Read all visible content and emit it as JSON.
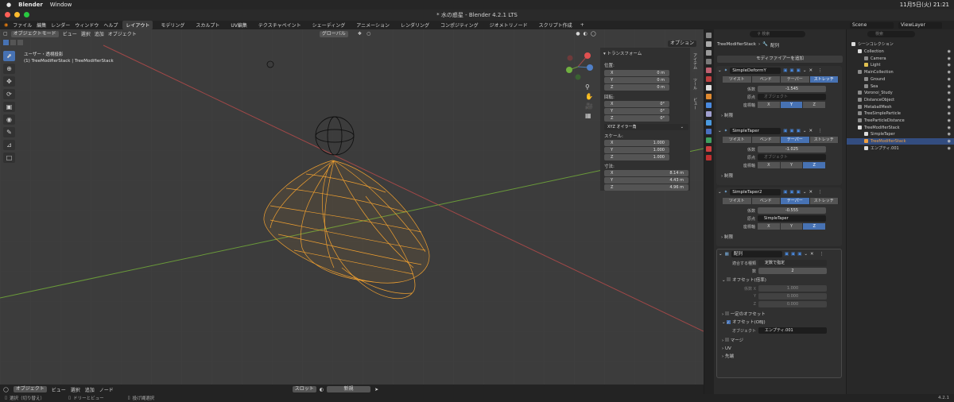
{
  "mac": {
    "app": "Blender",
    "menus": [
      "Window"
    ],
    "clock": "11月5日(火) 21:21"
  },
  "titlebar": {
    "title": "* 水の惑星 - Blender 4.2.1 LTS"
  },
  "topmenu": {
    "items": [
      "ファイル",
      "編集",
      "レンダー",
      "ウィンドウ",
      "ヘルプ"
    ],
    "tabs": [
      "レイアウト",
      "モデリング",
      "スカルプト",
      "UV編集",
      "テクスチャペイント",
      "シェーディング",
      "アニメーション",
      "レンダリング",
      "コンポジティング",
      "ジオメトリノード",
      "スクリプト作成"
    ],
    "add_tab": "+",
    "scene": "Scene",
    "viewlayer": "ViewLayer"
  },
  "viewport": {
    "mode": "オブジェクトモード",
    "menus": [
      "ビュー",
      "選択",
      "追加",
      "オブジェクト"
    ],
    "transform_orient": "グローバル",
    "options": "オプション",
    "overlay_text_1": "ユーザー・透視投影",
    "overlay_text_2": "(1) TreeModifierStack | TreeModifierStack",
    "side_tabs": [
      "アイテム",
      "ツール",
      "ビュー"
    ]
  },
  "npanel": {
    "header": "トランスフォーム",
    "location_label": "位置:",
    "location": [
      {
        "axis": "X",
        "value": "0 m"
      },
      {
        "axis": "Y",
        "value": "0 m"
      },
      {
        "axis": "Z",
        "value": "0 m"
      }
    ],
    "rotation_label": "回転:",
    "rotation": [
      {
        "axis": "X",
        "value": "0°"
      },
      {
        "axis": "Y",
        "value": "0°"
      },
      {
        "axis": "Z",
        "value": "0°"
      }
    ],
    "rotation_mode": "XYZ オイラー角",
    "scale_label": "スケール:",
    "scale": [
      {
        "axis": "X",
        "value": "1.000"
      },
      {
        "axis": "Y",
        "value": "1.000"
      },
      {
        "axis": "Z",
        "value": "1.000"
      }
    ],
    "dimensions_label": "寸法:",
    "dimensions": [
      {
        "axis": "X",
        "value": "8.14 m"
      },
      {
        "axis": "Y",
        "value": "4.43 m"
      },
      {
        "axis": "Z",
        "value": "4.96 m"
      }
    ]
  },
  "bottombar": {
    "mode": "オブジェクト",
    "menus": [
      "ビュー",
      "選択",
      "追加",
      "ノード"
    ],
    "slot": "スロット",
    "new_btn": "新規"
  },
  "status": {
    "items": [
      "選択（切り替え）",
      "ドリーとビュー",
      "投げ縄選択"
    ],
    "version": "4.2.1"
  },
  "properties": {
    "breadcrumb_obj": "TreeModifierStack",
    "breadcrumb_mod": "配列",
    "add_modifier": "モディファイアーを追加",
    "deform": {
      "name": "SimpleDeformY",
      "modes": [
        "ツイスト",
        "ベンド",
        "テーパー",
        "ストレッチ"
      ],
      "factor_label": "係数",
      "factor": "-1.545",
      "origin_label": "原点",
      "origin_placeholder": "オブジェクト",
      "axis_label": "座標軸",
      "axes": [
        "X",
        "Y",
        "Z"
      ],
      "restrictions": "制限"
    },
    "taper": {
      "name": "SimpleTaper",
      "modes": [
        "ツイスト",
        "ベンド",
        "テーパー",
        "ストレッチ"
      ],
      "factor_label": "係数",
      "factor": "-1.025",
      "origin_label": "原点",
      "origin_placeholder": "オブジェクト",
      "axis_label": "座標軸",
      "axes": [
        "X",
        "Y",
        "Z"
      ],
      "restrictions": "制限"
    },
    "taper2": {
      "name": "SimpleTaper2",
      "modes": [
        "ツイスト",
        "ベンド",
        "テーパー",
        "ストレッチ"
      ],
      "factor_label": "係数",
      "factor": "-0.555",
      "origin_label": "原点",
      "origin_value": "SimpleTaper",
      "axis_label": "座標軸",
      "axes": [
        "X",
        "Y",
        "Z"
      ],
      "restrictions": "制限"
    },
    "array": {
      "name": "配列",
      "fit_label": "適合する種類",
      "fit_value": "定数で指定",
      "count_label": "数",
      "count": "2",
      "relative_offset": "オフセット(倍率)",
      "factor_label": "係数 X",
      "factors": [
        {
          "axis": "Y",
          "value": "0.000"
        },
        {
          "axis": "Z",
          "value": "0.000"
        }
      ],
      "factor_x": "1.000",
      "constant_offset": "一定のオフセット",
      "object_offset": "オフセット(OBJ)",
      "object_label": "オブジェクト",
      "object_value": "エンプティ.001",
      "merge": "マージ",
      "uv": "UV",
      "caps": "先端"
    }
  },
  "outliner": {
    "search_placeholder": "検索",
    "root": "シーンコレクション",
    "items": [
      {
        "label": "Collection",
        "indent": 1,
        "color": "#dcdcdc"
      },
      {
        "label": "Camera",
        "indent": 2,
        "color": "#8c8c8c"
      },
      {
        "label": "Light",
        "indent": 2,
        "color": "#e0c050"
      },
      {
        "label": "MainCollection",
        "indent": 1,
        "color": "#8c8c8c"
      },
      {
        "label": "Ground",
        "indent": 2,
        "color": "#8c8c8c"
      },
      {
        "label": "Sea",
        "indent": 2,
        "color": "#8c8c8c"
      },
      {
        "label": "Voronoi_Study",
        "indent": 1,
        "color": "#8c8c8c"
      },
      {
        "label": "DistanceObject",
        "indent": 1,
        "color": "#8c8c8c"
      },
      {
        "label": "MetaballMesh",
        "indent": 1,
        "color": "#8c8c8c"
      },
      {
        "label": "TreeSimpleParticle",
        "indent": 1,
        "color": "#8c8c8c"
      },
      {
        "label": "TreeParticleDistance",
        "indent": 1,
        "color": "#8c8c8c"
      },
      {
        "label": "TreeModifierStack",
        "indent": 1,
        "color": "#dcdcdc"
      },
      {
        "label": "SimpleTaper",
        "indent": 2,
        "color": "#dcdcdc"
      },
      {
        "label": "TreeModifierStack",
        "indent": 2,
        "color": "#f0a040",
        "selected": true
      },
      {
        "label": "エンプティ.001",
        "indent": 2,
        "color": "#dcdcdc"
      }
    ]
  }
}
